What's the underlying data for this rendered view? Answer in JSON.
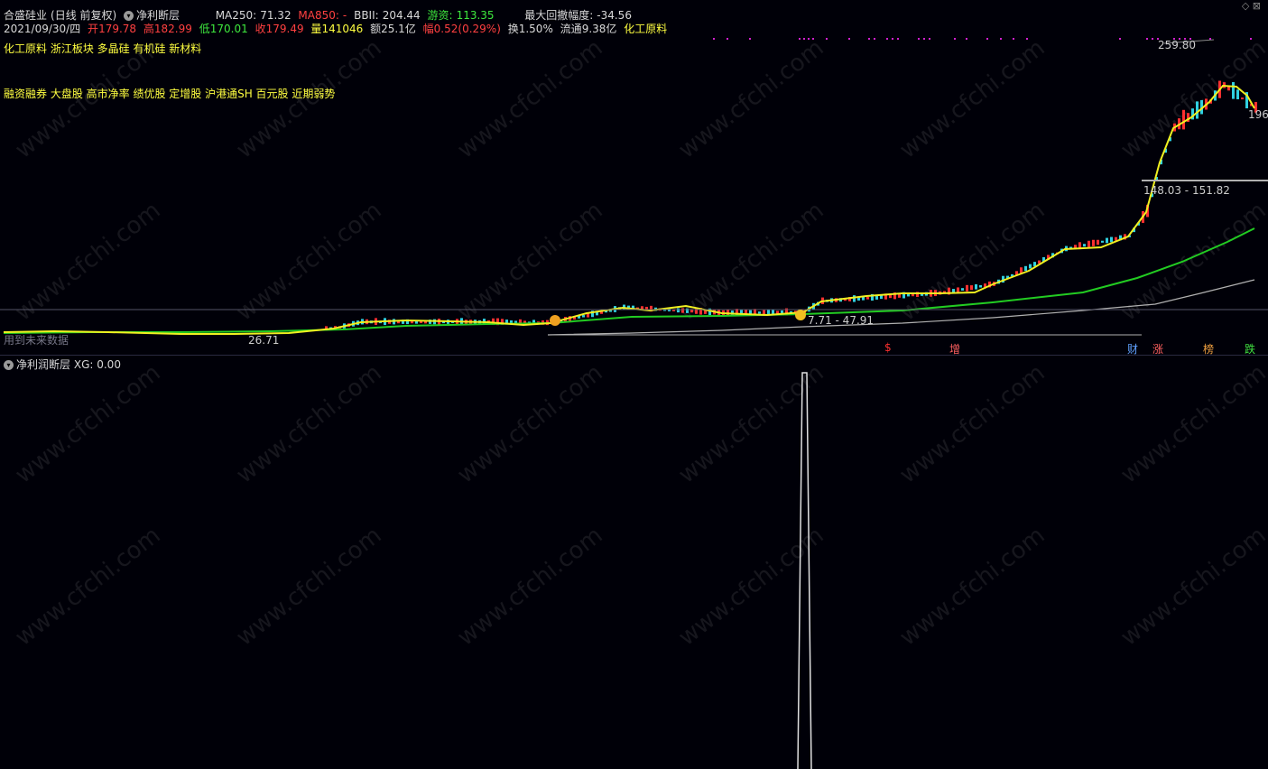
{
  "header": {
    "stock_name": "合盛硅业",
    "period_label": "(日线 前复权)",
    "indicator_name": "净利断层",
    "ma250_label": "MA250:",
    "ma250_value": "71.32",
    "ma850_label": "MA850:",
    "ma850_value": "-",
    "bbi_label": "BBII:",
    "bbi_value": "204.44",
    "youzi_label": "游资:",
    "youzi_value": "113.35",
    "max_drawdown_label": "最大回撤幅度:",
    "max_drawdown_value": "-34.56"
  },
  "quote": {
    "date": "2021/09/30/四",
    "open_label": "开",
    "open": "179.78",
    "high_label": "高",
    "high": "182.99",
    "low_label": "低",
    "low": "170.01",
    "close_label": "收",
    "close": "179.49",
    "volume_label": "量",
    "volume": "141046",
    "amount_label": "额",
    "amount": "25.1亿",
    "change_label": "幅",
    "change": "0.52(0.29%)",
    "turnover_label": "换",
    "turnover": "1.50%",
    "float_label": "流通",
    "float_value": "9.38亿",
    "industry": "化工原料"
  },
  "tags": {
    "line1": "化工原料 浙江板块 多晶硅 有机硅 新材料",
    "line2": "融资融券 大盘股 高市净率 绩优股 定增股 沪港通SH 百元股 近期弱势"
  },
  "chart_labels": {
    "peak": "259.80",
    "range_high": "148.03 - 151.82",
    "range_mid": "7.71 - 47.91",
    "low": "26.71",
    "right_value": "196",
    "left_note": "用到未来数据"
  },
  "markers": {
    "m1": "$",
    "m2": "增",
    "m3": "财",
    "m4": "涨",
    "m5": "榜",
    "m6": "跌"
  },
  "sub_panel": {
    "title": "净利润断层",
    "xg_label": "XG:",
    "xg_value": "0.00"
  },
  "watermark": "www.cfchi.com",
  "colors": {
    "background": "#000008",
    "ma_green": "#22cc22",
    "ma_yellow": "#f0f020",
    "ma_gray": "#b0b0b0",
    "candle_up": "#ff3030",
    "candle_down": "#30d0e0"
  }
}
